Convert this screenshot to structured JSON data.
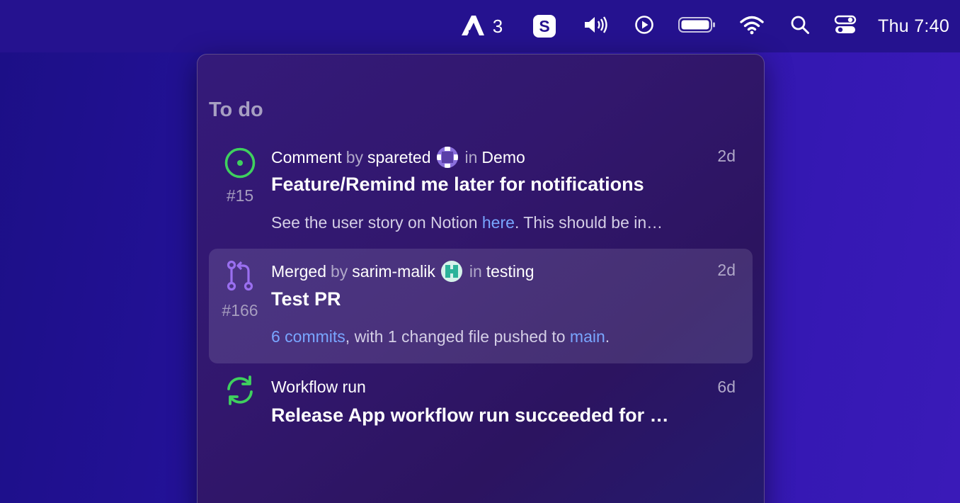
{
  "menubar": {
    "app_count": "3",
    "app_s_letter": "S",
    "clock": "Thu 7:40",
    "icons": [
      "app-logo-icon",
      "s-app-icon",
      "volume-icon",
      "play-circle-icon",
      "battery-icon",
      "wifi-icon",
      "search-icon",
      "control-center-icon"
    ]
  },
  "popover": {
    "section_title": "To do",
    "items": [
      {
        "type_label": "Comment",
        "by": "by",
        "author": "spareted",
        "in": "in",
        "repo": "Demo",
        "age": "2d",
        "number": "#15",
        "title": "Feature/Remind me later for notifications",
        "desc_pre": "See the user story on Notion ",
        "desc_link": "here",
        "desc_post": ". This should be in…",
        "icon": "issue-open-icon",
        "icon_color": "#3fd05e"
      },
      {
        "type_label": "Merged",
        "by": "by",
        "author": "sarim-malik",
        "in": "in",
        "repo": "testing",
        "age": "2d",
        "number": "#166",
        "title": "Test PR",
        "desc_link1": "6 commits",
        "desc_mid": ", with 1 changed file pushed to ",
        "desc_link2": "main",
        "desc_end": ".",
        "icon": "pull-request-merged-icon",
        "icon_color": "#9a6ff0",
        "selected": true
      },
      {
        "type_label": "Workflow run",
        "age": "6d",
        "title": "Release App workflow run succeeded for …",
        "icon": "workflow-sync-icon",
        "icon_color": "#3fd05e"
      }
    ]
  },
  "colors": {
    "link": "#79a6ff",
    "success": "#3fd05e",
    "merged": "#9a6ff0"
  }
}
